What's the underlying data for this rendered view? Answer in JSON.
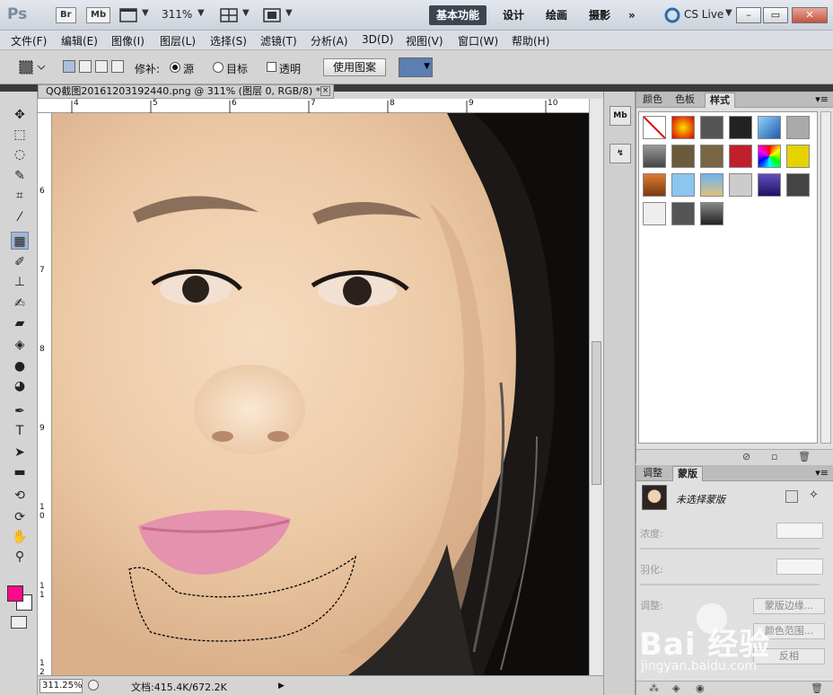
{
  "titlebar": {
    "app_logo": "Ps",
    "br_label": "Br",
    "mb_label": "Mb",
    "zoom": "311%",
    "workspaces": [
      "基本功能",
      "设计",
      "绘画",
      "摄影"
    ],
    "more": "»",
    "cslive": "CS Live",
    "window_buttons": [
      "–",
      "▭",
      "✕"
    ]
  },
  "menu": [
    "文件(F)",
    "编辑(E)",
    "图像(I)",
    "图层(L)",
    "选择(S)",
    "滤镜(T)",
    "分析(A)",
    "3D(D)",
    "视图(V)",
    "窗口(W)",
    "帮助(H)"
  ],
  "options": {
    "patch_label": "修补:",
    "source_label": "源",
    "target_label": "目标",
    "transparent_label": "透明",
    "use_pattern_label": "使用图案"
  },
  "document": {
    "tab_title": "QQ截图20161203192440.png @ 311% (图层 0, RGB/8) *",
    "ruler_top": [
      "4",
      "5",
      "6",
      "7",
      "8",
      "9",
      "10"
    ],
    "ruler_left": [
      "6",
      "7",
      "8",
      "9",
      "1 0",
      "1 1",
      "1 2"
    ],
    "zoom_status": "311.25%",
    "doc_info": "文档:415.4K/672.2K"
  },
  "styles_panel": {
    "tabs": [
      "颜色",
      "色板",
      "样式"
    ],
    "active_tab": "样式"
  },
  "masks_panel": {
    "tabs": [
      "调整",
      "蒙版"
    ],
    "active_tab": "蒙版",
    "title": "未选择蒙版",
    "density_label": "浓度:",
    "feather_label": "羽化:",
    "adjust_label": "调整:",
    "mask_edge_btn": "蒙版边缘...",
    "color_range_btn": "颜色范围...",
    "invert_btn": "反相"
  },
  "watermark": {
    "brand": "Bai 经验",
    "url": "jingyan.baidu.com"
  },
  "colors": {
    "foreground": "#ff0a8a",
    "background": "#ffffff",
    "workspace_active": "#3d4550"
  }
}
